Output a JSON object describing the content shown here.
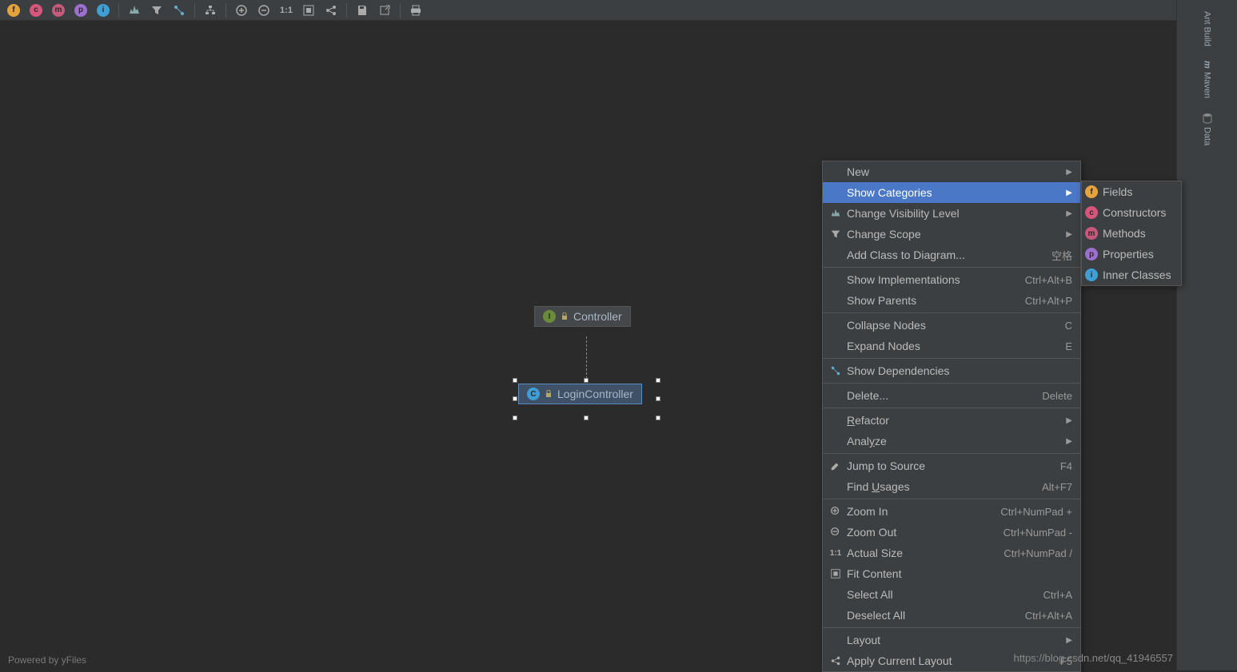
{
  "toolbar": {
    "badges": [
      "f",
      "c",
      "m",
      "p",
      "i"
    ],
    "zoom": {
      "in": "+",
      "out": "-",
      "actual": "1:1"
    }
  },
  "diagram": {
    "parent": {
      "name": "Controller",
      "kind": "interface"
    },
    "child": {
      "name": "LoginController",
      "kind": "class"
    }
  },
  "context_menu": {
    "items": [
      {
        "label": "New",
        "arrow": true
      },
      {
        "label": "Show Categories",
        "arrow": true,
        "highlight": true
      },
      {
        "label": "Change Visibility Level",
        "arrow": true,
        "icon": "visibility"
      },
      {
        "label": "Change Scope",
        "arrow": true,
        "icon": "filter"
      },
      {
        "label": "Add Class to Diagram...",
        "shortcut": "空格"
      },
      {
        "sep": true
      },
      {
        "label": "Show Implementations",
        "shortcut": "Ctrl+Alt+B"
      },
      {
        "label": "Show Parents",
        "shortcut": "Ctrl+Alt+P"
      },
      {
        "sep": true
      },
      {
        "label": "Collapse Nodes",
        "shortcut": "C"
      },
      {
        "label": "Expand Nodes",
        "shortcut": "E"
      },
      {
        "sep": true
      },
      {
        "label": "Show Dependencies",
        "icon": "deps"
      },
      {
        "sep": true
      },
      {
        "label": "Delete...",
        "shortcut": "Delete"
      },
      {
        "sep": true
      },
      {
        "label": "Refactor",
        "arrow": true,
        "u": 0
      },
      {
        "label": "Analyze",
        "arrow": true,
        "u": 4
      },
      {
        "sep": true
      },
      {
        "label": "Jump to Source",
        "shortcut": "F4",
        "icon": "edit"
      },
      {
        "label": "Find Usages",
        "shortcut": "Alt+F7",
        "u": 5
      },
      {
        "sep": true
      },
      {
        "label": "Zoom In",
        "shortcut": "Ctrl+NumPad +",
        "icon": "zin"
      },
      {
        "label": "Zoom Out",
        "shortcut": "Ctrl+NumPad -",
        "icon": "zout"
      },
      {
        "label": "Actual Size",
        "shortcut": "Ctrl+NumPad /",
        "icon": "as"
      },
      {
        "label": "Fit Content",
        "icon": "fit"
      },
      {
        "label": "Select All",
        "shortcut": "Ctrl+A"
      },
      {
        "label": "Deselect All",
        "shortcut": "Ctrl+Alt+A"
      },
      {
        "sep": true
      },
      {
        "label": "Layout",
        "arrow": true
      },
      {
        "label": "Apply Current Layout",
        "shortcut": "F5",
        "icon": "layout"
      }
    ]
  },
  "submenu": {
    "items": [
      {
        "label": "Fields",
        "badge": "f",
        "cls": "c-f"
      },
      {
        "label": "Constructors",
        "badge": "c",
        "cls": "c-c"
      },
      {
        "label": "Methods",
        "badge": "m",
        "cls": "c-m"
      },
      {
        "label": "Properties",
        "badge": "p",
        "cls": "c-p"
      },
      {
        "label": "Inner Classes",
        "badge": "i",
        "cls": "c-i"
      }
    ]
  },
  "right_panel": {
    "items": [
      "Ant Build",
      "Maven",
      "Data"
    ]
  },
  "footer": {
    "powered": "Powered by yFiles"
  },
  "watermark": "https://blog.csdn.net/qq_41946557"
}
